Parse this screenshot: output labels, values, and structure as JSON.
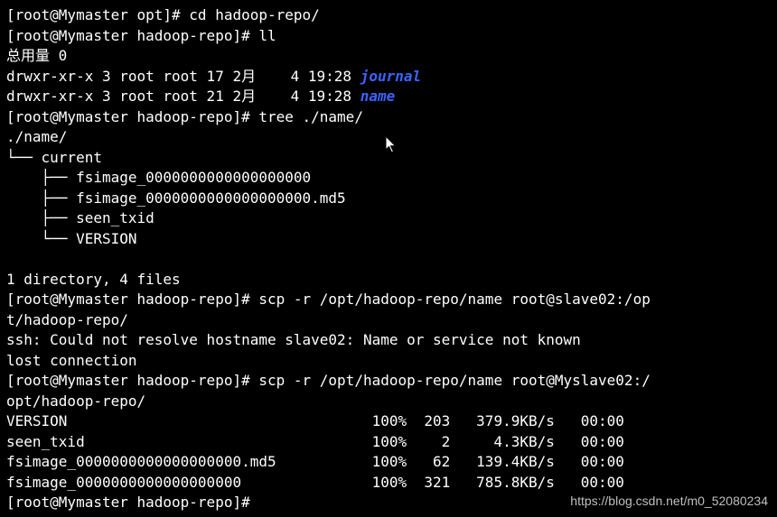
{
  "terminal": {
    "lines": [
      "[root@Mymaster opt]# cd hadoop-repo/",
      "[root@Mymaster hadoop-repo]# ll",
      "总用量 0",
      "drwxr-xr-x 3 root root 17 2月    4 19:28 ",
      "drwxr-xr-x 3 root root 21 2月    4 19:28 ",
      "[root@Mymaster hadoop-repo]# tree ./name/",
      "./name/",
      "└── current",
      "    ├── fsimage_0000000000000000000",
      "    ├── fsimage_0000000000000000000.md5",
      "    ├── seen_txid",
      "    └── VERSION",
      "",
      "1 directory, 4 files",
      "[root@Mymaster hadoop-repo]# scp -r /opt/hadoop-repo/name root@slave02:/op",
      "t/hadoop-repo/",
      "ssh: Could not resolve hostname slave02: Name or service not known",
      "lost connection",
      "[root@Mymaster hadoop-repo]# scp -r /opt/hadoop-repo/name root@Myslave02:/",
      "opt/hadoop-repo/",
      "VERSION                                   100%  203   379.9KB/s   00:00",
      "seen_txid                                 100%    2     4.3KB/s   00:00",
      "fsimage_0000000000000000000.md5           100%   62   139.4KB/s   00:00",
      "fsimage_0000000000000000000               100%  321   785.8KB/s   00:00",
      "[root@Mymaster hadoop-repo]# "
    ],
    "dir_journal": "journal",
    "dir_name": "name"
  },
  "watermark": "https://blog.csdn.net/m0_52080234",
  "colors": {
    "background": "#000000",
    "text": "#ffffff",
    "directory": "#3b63ff"
  }
}
